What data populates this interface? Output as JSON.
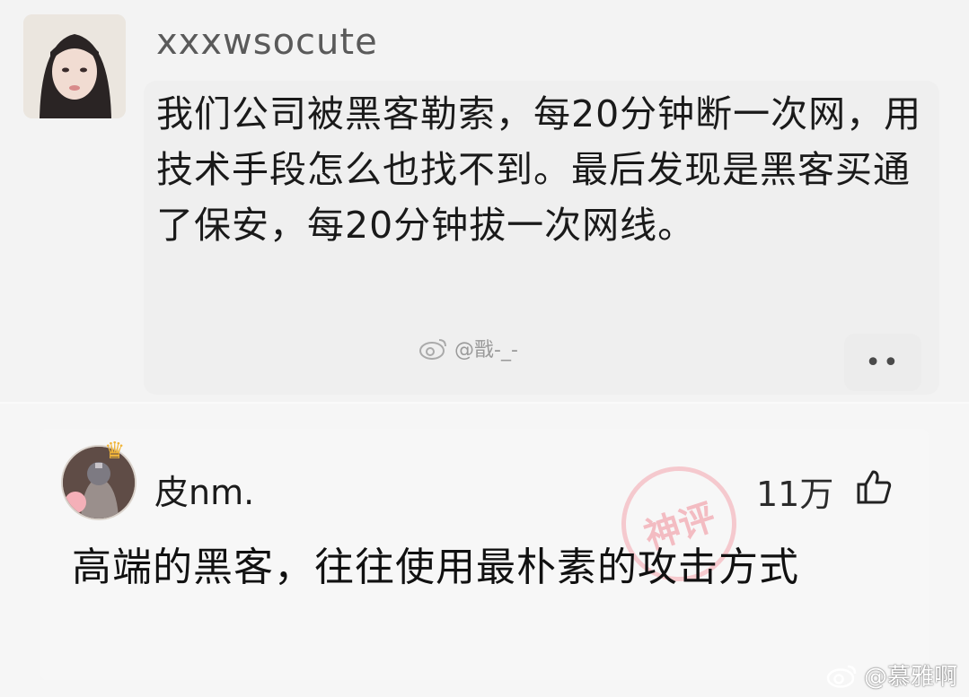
{
  "post": {
    "username": "xxxwsocute",
    "text": "我们公司被黑客勒索，每20分钟断一次网，用技术手段怎么也找不到。最后发现是黑客买通了保安，每20分钟拔一次网线。",
    "watermark": "@戬-_-",
    "more_icon": "••"
  },
  "comment": {
    "username": "皮nm.",
    "badge": "神评",
    "likes": "11万",
    "text": "高端的黑客，往往使用最朴素的攻击方式"
  },
  "footer": {
    "watermark": "@慕雅啊"
  },
  "colors": {
    "background": "#f6f6f6",
    "stamp": "#f08c98",
    "crown": "#f0b53a"
  }
}
